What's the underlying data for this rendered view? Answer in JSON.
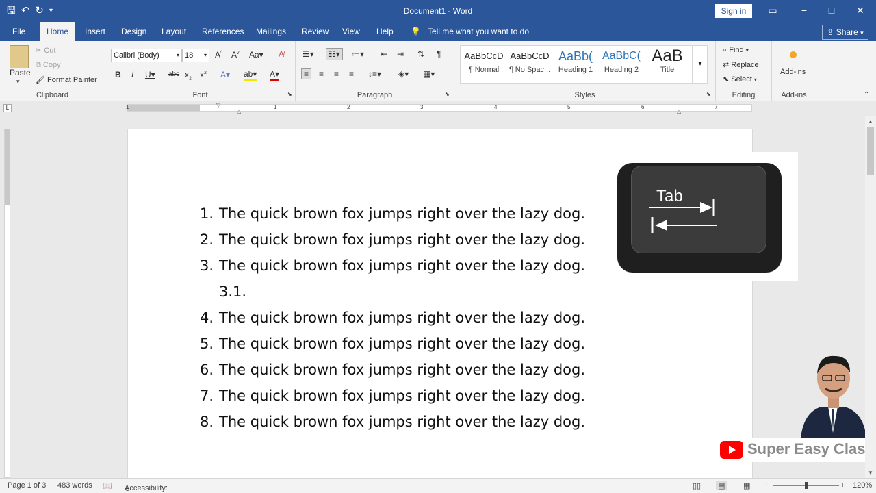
{
  "window": {
    "title": "Document1 - Word",
    "sign_in": "Sign in",
    "controls": [
      "−",
      "□",
      "✕"
    ]
  },
  "quick_access": {
    "icons": [
      "save-icon",
      "undo-icon",
      "redo-icon",
      "customize-icon"
    ]
  },
  "tabs": [
    {
      "label": "File"
    },
    {
      "label": "Home"
    },
    {
      "label": "Insert"
    },
    {
      "label": "Design"
    },
    {
      "label": "Layout"
    },
    {
      "label": "References"
    },
    {
      "label": "Mailings"
    },
    {
      "label": "Review"
    },
    {
      "label": "View"
    },
    {
      "label": "Help"
    }
  ],
  "active_tab": "Home",
  "tell_me": "Tell me what you want to do",
  "share": "Share",
  "ribbon": {
    "clipboard": {
      "label": "Clipboard",
      "paste": "Paste",
      "cut": "Cut",
      "copy": "Copy",
      "format_painter": "Format Painter"
    },
    "font": {
      "label": "Font",
      "family": "Calibri (Body)",
      "size": "18"
    },
    "paragraph": {
      "label": "Paragraph"
    },
    "styles": {
      "label": "Styles",
      "items": [
        {
          "preview": "AaBbCcD",
          "name": "¶ Normal"
        },
        {
          "preview": "AaBbCcD",
          "name": "¶ No Spac..."
        },
        {
          "preview": "AaBb(",
          "name": "Heading 1"
        },
        {
          "preview": "AaBbC(",
          "name": "Heading 2"
        },
        {
          "preview": "AaB",
          "name": "Title"
        }
      ]
    },
    "editing": {
      "label": "Editing",
      "find": "Find",
      "replace": "Replace",
      "select": "Select"
    },
    "addins": {
      "label": "Add-ins",
      "button": "Add-ins"
    }
  },
  "ruler": {
    "ticks": [
      "1",
      "1",
      "2",
      "3",
      "4",
      "5",
      "6",
      "7"
    ]
  },
  "document": {
    "list": [
      {
        "num": "1.",
        "text": "The quick brown fox jumps right over the lazy dog."
      },
      {
        "num": "2.",
        "text": "The quick brown fox jumps right over the lazy dog."
      },
      {
        "num": "3.",
        "text": "The quick brown fox jumps right over the lazy dog."
      },
      {
        "num": "3.1.",
        "text": ""
      },
      {
        "num": "4.",
        "text": "The quick brown fox jumps right over the lazy dog."
      },
      {
        "num": "5.",
        "text": "The quick brown fox jumps right over the lazy dog."
      },
      {
        "num": "6.",
        "text": "The quick brown fox jumps right over the lazy dog."
      },
      {
        "num": "7.",
        "text": "The quick brown fox jumps right over the lazy dog."
      },
      {
        "num": "8.",
        "text": "The quick brown fox jumps right over the lazy dog."
      }
    ]
  },
  "tab_key_image": {
    "label": "Tab"
  },
  "brand": {
    "name": "Super Easy Class"
  },
  "status": {
    "page": "Page 1 of 3",
    "words": "483 words",
    "accessibility": "Accessibility: Good to go",
    "zoom": "120%"
  }
}
